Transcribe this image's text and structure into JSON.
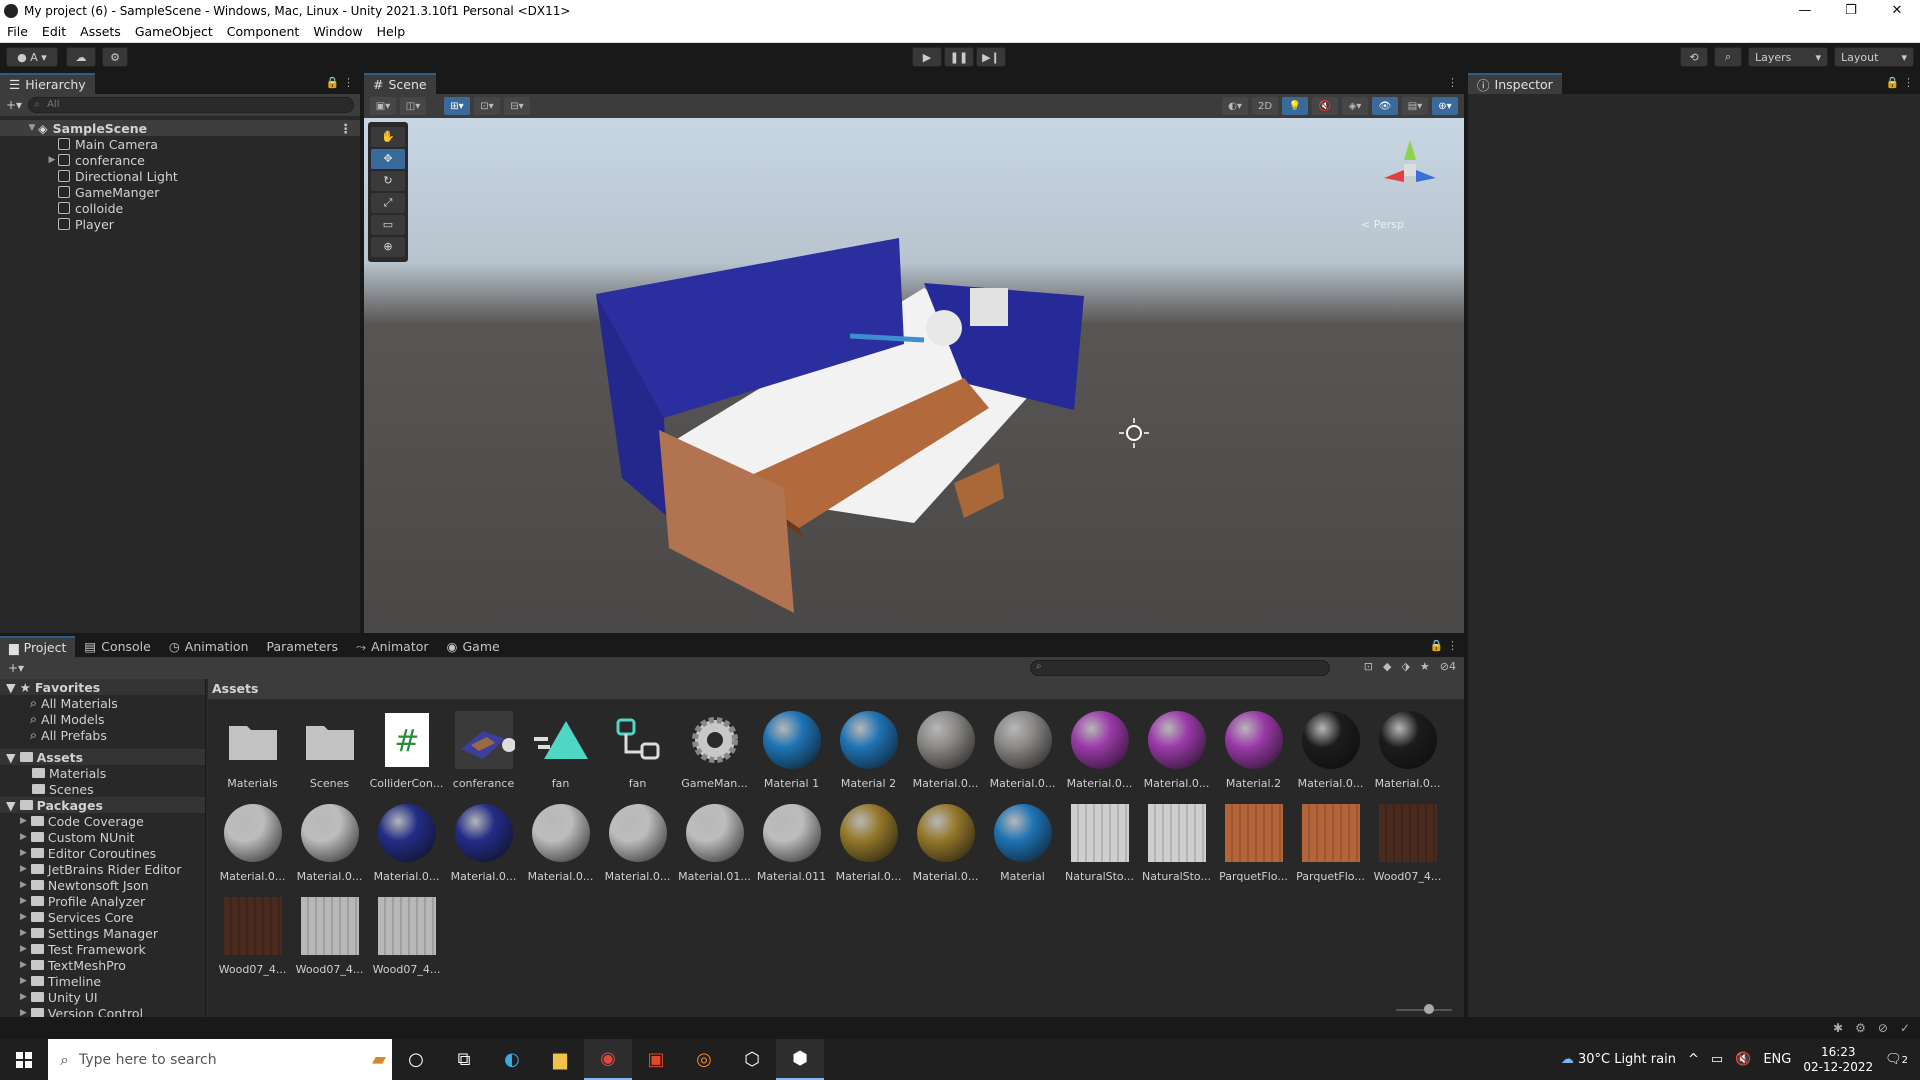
{
  "window": {
    "title": "My project (6) - SampleScene - Windows, Mac, Linux - Unity 2021.3.10f1 Personal <DX11>",
    "minimize": "—",
    "restore": "❐",
    "close": "✕"
  },
  "menu": [
    "File",
    "Edit",
    "Assets",
    "GameObject",
    "Component",
    "Window",
    "Help"
  ],
  "toolbar": {
    "account_label": "A",
    "layers_label": "Layers",
    "layout_label": "Layout"
  },
  "hierarchy": {
    "tab_label": "Hierarchy",
    "search_placeholder": "All",
    "scene_name": "SampleScene",
    "items": [
      "Main Camera",
      "conferance",
      "Directional Light",
      "GameManger",
      "colloide",
      "Player"
    ]
  },
  "scene": {
    "tab_label": "Scene",
    "mode_2d": "2D",
    "persp_label": "< Persp"
  },
  "inspector": {
    "tab_label": "Inspector"
  },
  "bottom_tabs": [
    "Project",
    "Console",
    "Animation",
    "Parameters",
    "Animator",
    "Game"
  ],
  "project": {
    "favorites_label": "Favorites",
    "favorites": [
      "All Materials",
      "All Models",
      "All Prefabs"
    ],
    "assets_label": "Assets",
    "asset_folders": [
      "Materials",
      "Scenes"
    ],
    "packages_label": "Packages",
    "packages": [
      "Code Coverage",
      "Custom NUnit",
      "Editor Coroutines",
      "JetBrains Rider Editor",
      "Newtonsoft Json",
      "Profile Analyzer",
      "Services Core",
      "Settings Manager",
      "Test Framework",
      "TextMeshPro",
      "Timeline",
      "Unity UI",
      "Version Control"
    ],
    "breadcrumb": "Assets",
    "visibility_count": "4",
    "assets": [
      {
        "label": "Materials",
        "kind": "folder"
      },
      {
        "label": "Scenes",
        "kind": "folder"
      },
      {
        "label": "ColliderCon...",
        "kind": "script"
      },
      {
        "label": "conferance",
        "kind": "model"
      },
      {
        "label": "fan",
        "kind": "animclip"
      },
      {
        "label": "fan",
        "kind": "controller"
      },
      {
        "label": "GameMan...",
        "kind": "gear"
      },
      {
        "label": "Material 1",
        "kind": "sphere",
        "color": "#1e73b4"
      },
      {
        "label": "Material 2",
        "kind": "sphere",
        "color": "#1e73b4"
      },
      {
        "label": "Material.0...",
        "kind": "sphere",
        "color": "#8a8885"
      },
      {
        "label": "Material.0...",
        "kind": "sphere",
        "color": "#8a8885"
      },
      {
        "label": "Material.0...",
        "kind": "sphere",
        "color": "#9a3aa8"
      },
      {
        "label": "Material.0...",
        "kind": "sphere",
        "color": "#9a3aa8"
      },
      {
        "label": "Material.2",
        "kind": "sphere",
        "color": "#9a3aa8"
      },
      {
        "label": "Material.0...",
        "kind": "sphere",
        "color": "#1c1c1e"
      },
      {
        "label": "Material.0...",
        "kind": "sphere",
        "color": "#1c1c1e"
      },
      {
        "label": "Material.0...",
        "kind": "sphere",
        "color": "#bdbdbd"
      },
      {
        "label": "Material.0...",
        "kind": "sphere",
        "color": "#bdbdbd"
      },
      {
        "label": "Material.0...",
        "kind": "sphere",
        "color": "#222d86"
      },
      {
        "label": "Material.0...",
        "kind": "sphere",
        "color": "#222d86"
      },
      {
        "label": "Material.0...",
        "kind": "sphere",
        "color": "#bdbdbd"
      },
      {
        "label": "Material.0...",
        "kind": "sphere",
        "color": "#bdbdbd"
      },
      {
        "label": "Material.01...",
        "kind": "sphere",
        "color": "#bdbdbd"
      },
      {
        "label": "Material.011",
        "kind": "sphere",
        "color": "#bdbdbd"
      },
      {
        "label": "Material.0...",
        "kind": "sphere",
        "color": "#94782a"
      },
      {
        "label": "Material.0...",
        "kind": "sphere",
        "color": "#94782a"
      },
      {
        "label": "Material",
        "kind": "sphere",
        "color": "#1e73b4"
      },
      {
        "label": "NaturalSto...",
        "kind": "texture",
        "color": "#cfcfcf"
      },
      {
        "label": "NaturalSto...",
        "kind": "texture",
        "color": "#cfcfcf"
      },
      {
        "label": "ParquetFlo...",
        "kind": "texture",
        "color": "#b5643a"
      },
      {
        "label": "ParquetFlo...",
        "kind": "texture",
        "color": "#b5643a"
      },
      {
        "label": "Wood07_4...",
        "kind": "texture",
        "color": "#4a2a1e"
      },
      {
        "label": "Wood07_4...",
        "kind": "texture",
        "color": "#4a2a1e"
      },
      {
        "label": "Wood07_4...",
        "kind": "texture",
        "color": "#b8b8b8"
      },
      {
        "label": "Wood07_4...",
        "kind": "texture",
        "color": "#b8b8b8"
      }
    ]
  },
  "taskbar": {
    "search_placeholder": "Type here to search",
    "weather": "30°C  Light rain",
    "language": "ENG",
    "time": "16:23",
    "date": "02-12-2022",
    "notifications": "2"
  }
}
